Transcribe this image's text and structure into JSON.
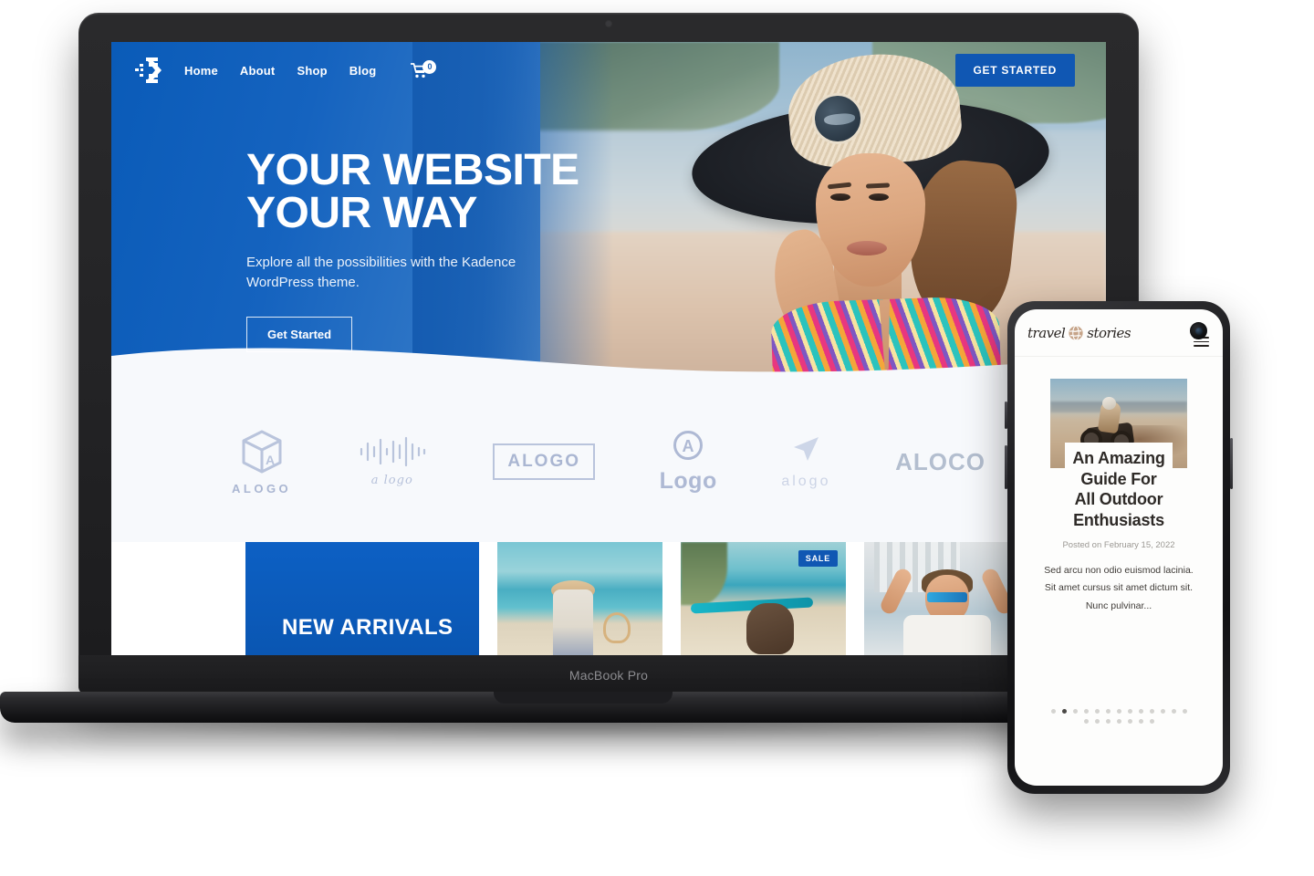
{
  "device_laptop": {
    "brand_label": "MacBook Pro"
  },
  "site": {
    "logo_icon": "kadence-logo-icon",
    "nav": [
      {
        "label": "Home"
      },
      {
        "label": "About"
      },
      {
        "label": "Shop"
      },
      {
        "label": "Blog"
      }
    ],
    "cart": {
      "icon": "shopping-cart-icon",
      "count": "0"
    },
    "header_cta": {
      "label": "GET STARTED"
    },
    "hero": {
      "title": "YOUR WEBSITE\nYOUR WAY",
      "subtitle": "Explore all the possibilities with the Kadence WordPress theme.",
      "cta": {
        "label": "Get Started"
      },
      "background_color": "#1563bf"
    },
    "logo_strip": [
      {
        "name": "ALOGO",
        "icon": "cube-a-icon",
        "style": "cube"
      },
      {
        "name": "a logo",
        "icon": "waveform-icon",
        "style": "waveform"
      },
      {
        "name": "ALOGO",
        "icon": "boxed-text-icon",
        "style": "boxed"
      },
      {
        "name": "Logo",
        "icon": "circle-a-icon",
        "style": "circle-a"
      },
      {
        "name": "alogo",
        "icon": "paper-plane-icon",
        "style": "plane"
      },
      {
        "name": "ALOCO",
        "icon": "aloco-wordmark-icon",
        "style": "aloco"
      }
    ],
    "products": {
      "promo_card": {
        "label": "NEW ARRIVALS",
        "color": "#0d60c4"
      },
      "cards": [
        {
          "alt": "woman-on-beach-with-hat",
          "badge": ""
        },
        {
          "alt": "dog-on-surfboard-beach",
          "badge": "SALE"
        },
        {
          "alt": "man-with-sunglasses",
          "badge": ""
        },
        {
          "alt": "partial-product-card",
          "badge": ""
        }
      ]
    }
  },
  "phone_site": {
    "brand": {
      "word_one": "travel",
      "word_two": "stories",
      "icon": "globe-icon"
    },
    "menu_icon": "hamburger-menu-icon",
    "camera": "front-camera-punch-hole",
    "article": {
      "image_alt": "motorcycle-rider-in-desert",
      "title": "An Amazing\nGuide For\nAll Outdoor\nEnthusiasts",
      "date": "Posted on February 15, 2022",
      "excerpt": "Sed arcu non odio euismod lacinia. Sit amet cursus sit amet dictum sit. Nunc pulvinar..."
    },
    "pagination": {
      "row_one_count": 13,
      "row_one_active_index": 1,
      "row_two_count": 7
    }
  }
}
